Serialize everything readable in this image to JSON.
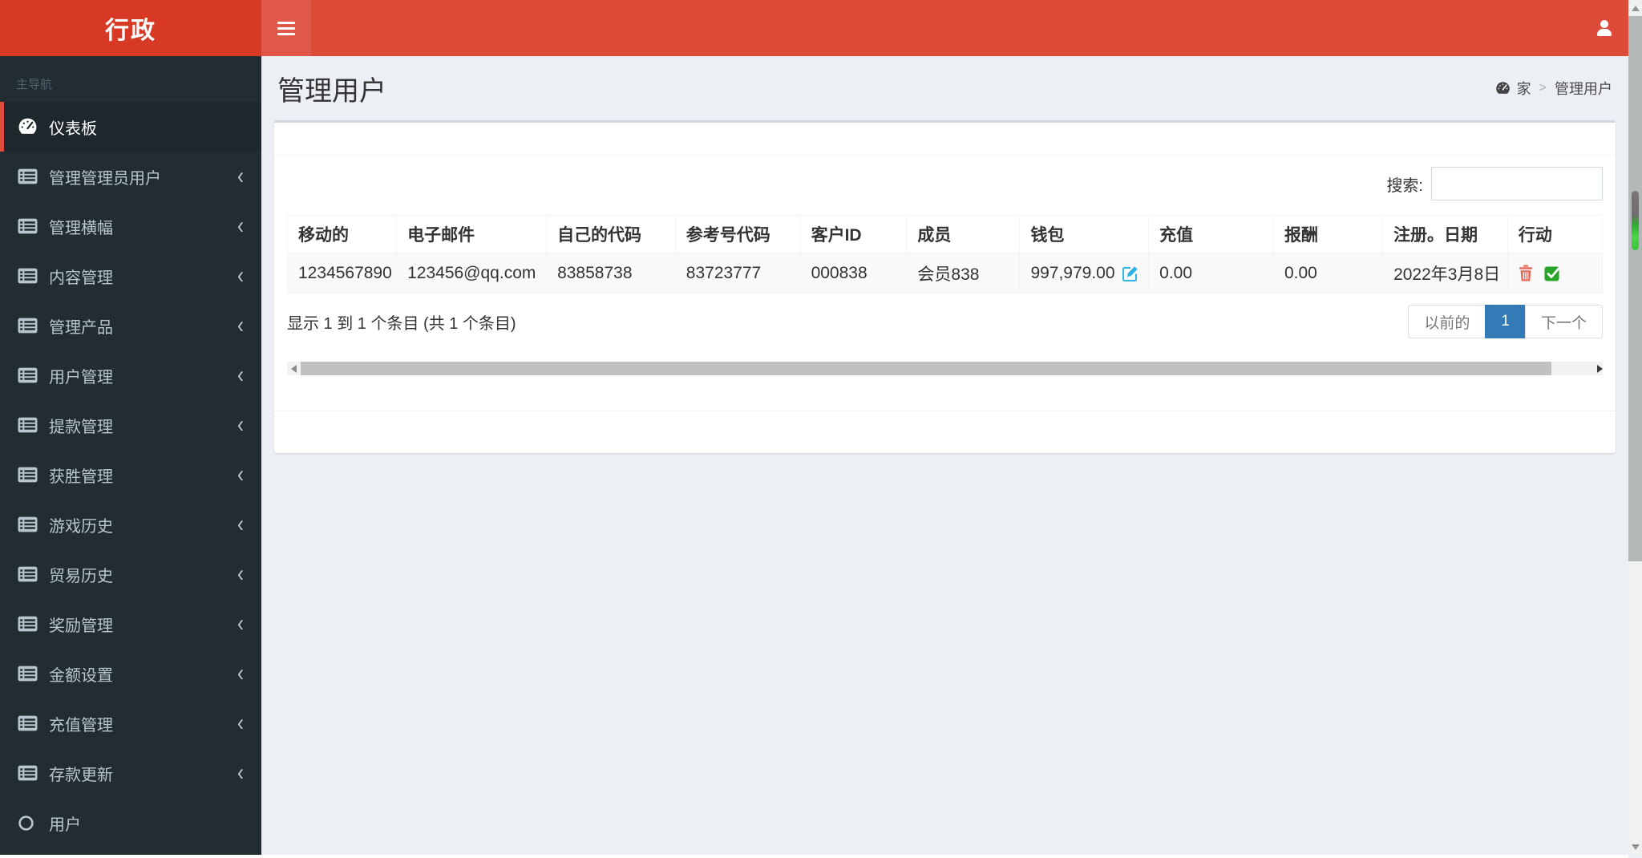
{
  "header": {
    "logo": "行政"
  },
  "sidebar": {
    "section_label": "主导航",
    "items": [
      {
        "label": "仪表板",
        "icon": "gauge-icon",
        "active": true,
        "has_submenu": false
      },
      {
        "label": "管理管理员用户",
        "icon": "list-icon",
        "active": false,
        "has_submenu": true
      },
      {
        "label": "管理横幅",
        "icon": "list-icon",
        "active": false,
        "has_submenu": true
      },
      {
        "label": "内容管理",
        "icon": "list-icon",
        "active": false,
        "has_submenu": true
      },
      {
        "label": "管理产品",
        "icon": "list-icon",
        "active": false,
        "has_submenu": true
      },
      {
        "label": "用户管理",
        "icon": "list-icon",
        "active": false,
        "has_submenu": true
      },
      {
        "label": "提款管理",
        "icon": "list-icon",
        "active": false,
        "has_submenu": true
      },
      {
        "label": "获胜管理",
        "icon": "list-icon",
        "active": false,
        "has_submenu": true
      },
      {
        "label": "游戏历史",
        "icon": "list-icon",
        "active": false,
        "has_submenu": true
      },
      {
        "label": "贸易历史",
        "icon": "list-icon",
        "active": false,
        "has_submenu": true
      },
      {
        "label": "奖励管理",
        "icon": "list-icon",
        "active": false,
        "has_submenu": true
      },
      {
        "label": "金额设置",
        "icon": "list-icon",
        "active": false,
        "has_submenu": true
      },
      {
        "label": "充值管理",
        "icon": "list-icon",
        "active": false,
        "has_submenu": true
      },
      {
        "label": "存款更新",
        "icon": "list-icon",
        "active": false,
        "has_submenu": true
      },
      {
        "label": "用户",
        "icon": "circle-icon",
        "active": false,
        "has_submenu": false
      }
    ]
  },
  "page": {
    "title": "管理用户",
    "breadcrumb": {
      "home": "家",
      "separator": ">",
      "current": "管理用户"
    }
  },
  "panel": {
    "search": {
      "label": "搜索:",
      "value": ""
    },
    "table": {
      "columns": [
        "移动的",
        "电子邮件",
        "自己的代码",
        "参考号代码",
        "客户ID",
        "成员",
        "钱包",
        "充值",
        "报酬",
        "注册。日期",
        "行动"
      ],
      "row": {
        "mobile": "1234567890",
        "email": "123456@qq.com",
        "own_code": "83858738",
        "ref_code": "83723777",
        "customer_id": "000838",
        "member": "会员838",
        "wallet": "997,979.00",
        "recharge": "0.00",
        "reward": "0.00",
        "reg_date": "2022年3月8日"
      }
    },
    "info": "显示 1 到 1 个条目 (共 1 个条目)",
    "pagination": {
      "previous": "以前的",
      "current_page": "1",
      "next": "下一个"
    }
  },
  "colors": {
    "navbar_red": "#dd4b39",
    "logo_red": "#d73925",
    "sidebar_dark": "#222d32",
    "active_page_blue": "#337ab7",
    "edit_blue": "#2eb2e8",
    "delete_red": "#e8695b",
    "confirm_green": "#28a428"
  }
}
